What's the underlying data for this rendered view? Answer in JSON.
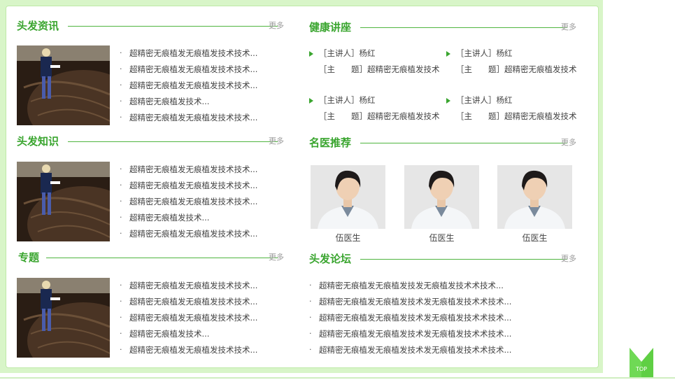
{
  "sections": {
    "hair_news": {
      "title": "头发资讯",
      "more": "更多",
      "items": [
        "超精密无痕植发无痕植发技术技术...",
        "超精密无痕植发无痕植发技术技术...",
        "超精密无痕植发无痕植发技术技术...",
        "超精密无痕植发技术...",
        "超精密无痕植发无痕植发技术技术..."
      ]
    },
    "hair_knowledge": {
      "title": "头发知识",
      "more": "更多",
      "items": [
        "超精密无痕植发无痕植发技术技术...",
        "超精密无痕植发无痕植发技术技术...",
        "超精密无痕植发无痕植发技术技术...",
        "超精密无痕植发技术...",
        "超精密无痕植发无痕植发技术技术..."
      ]
    },
    "topics": {
      "title": "专题",
      "more": "更多",
      "items": [
        "超精密无痕植发无痕植发技术技术...",
        "超精密无痕植发无痕植发技术技术...",
        "超精密无痕植发无痕植发技术技术...",
        "超精密无痕植发技术...",
        "超精密无痕植发无痕植发技术技术..."
      ]
    },
    "health_lectures": {
      "title": "健康讲座",
      "more": "更多",
      "lectures": [
        {
          "speaker": "［主讲人］杨红",
          "topic": "［主　　题］超精密无痕植发技术"
        },
        {
          "speaker": "［主讲人］杨红",
          "topic": "［主　　题］超精密无痕植发技术"
        },
        {
          "speaker": "［主讲人］杨红",
          "topic": "［主　　题］超精密无痕植发技术"
        },
        {
          "speaker": "［主讲人］杨红",
          "topic": "［主　　题］超精密无痕植发技术"
        }
      ]
    },
    "famous_doctors": {
      "title": "名医推荐",
      "more": "更多",
      "doctors": [
        {
          "name": "伍医生"
        },
        {
          "name": "伍医生"
        },
        {
          "name": "伍医生"
        }
      ]
    },
    "hair_forum": {
      "title": "头发论坛",
      "more": "更多",
      "items": [
        "超精密无痕植发无痕植发技发无痕植发技术术技术...",
        "超精密无痕植发无痕植发技术发无痕植发技术术技术...",
        "超精密无痕植发无痕植发技术发无痕植发技术术技术...",
        "超精密无痕植发无痕植发技术发无痕植发技术术技术...",
        "超精密无痕植发无痕植发技术发无痕植发技术术技术..."
      ]
    }
  },
  "bullet": "·",
  "top_button": {
    "label": "TOP"
  },
  "colors": {
    "accent": "#3aa52f",
    "frame": "#d8f5c8",
    "more": "#9a9a9a"
  },
  "icons": {
    "thumb": "hair-thumbnail-image",
    "doctor": "doctor-photo",
    "arrow": "green-triangle-icon",
    "top": "top-arrow-icon"
  }
}
